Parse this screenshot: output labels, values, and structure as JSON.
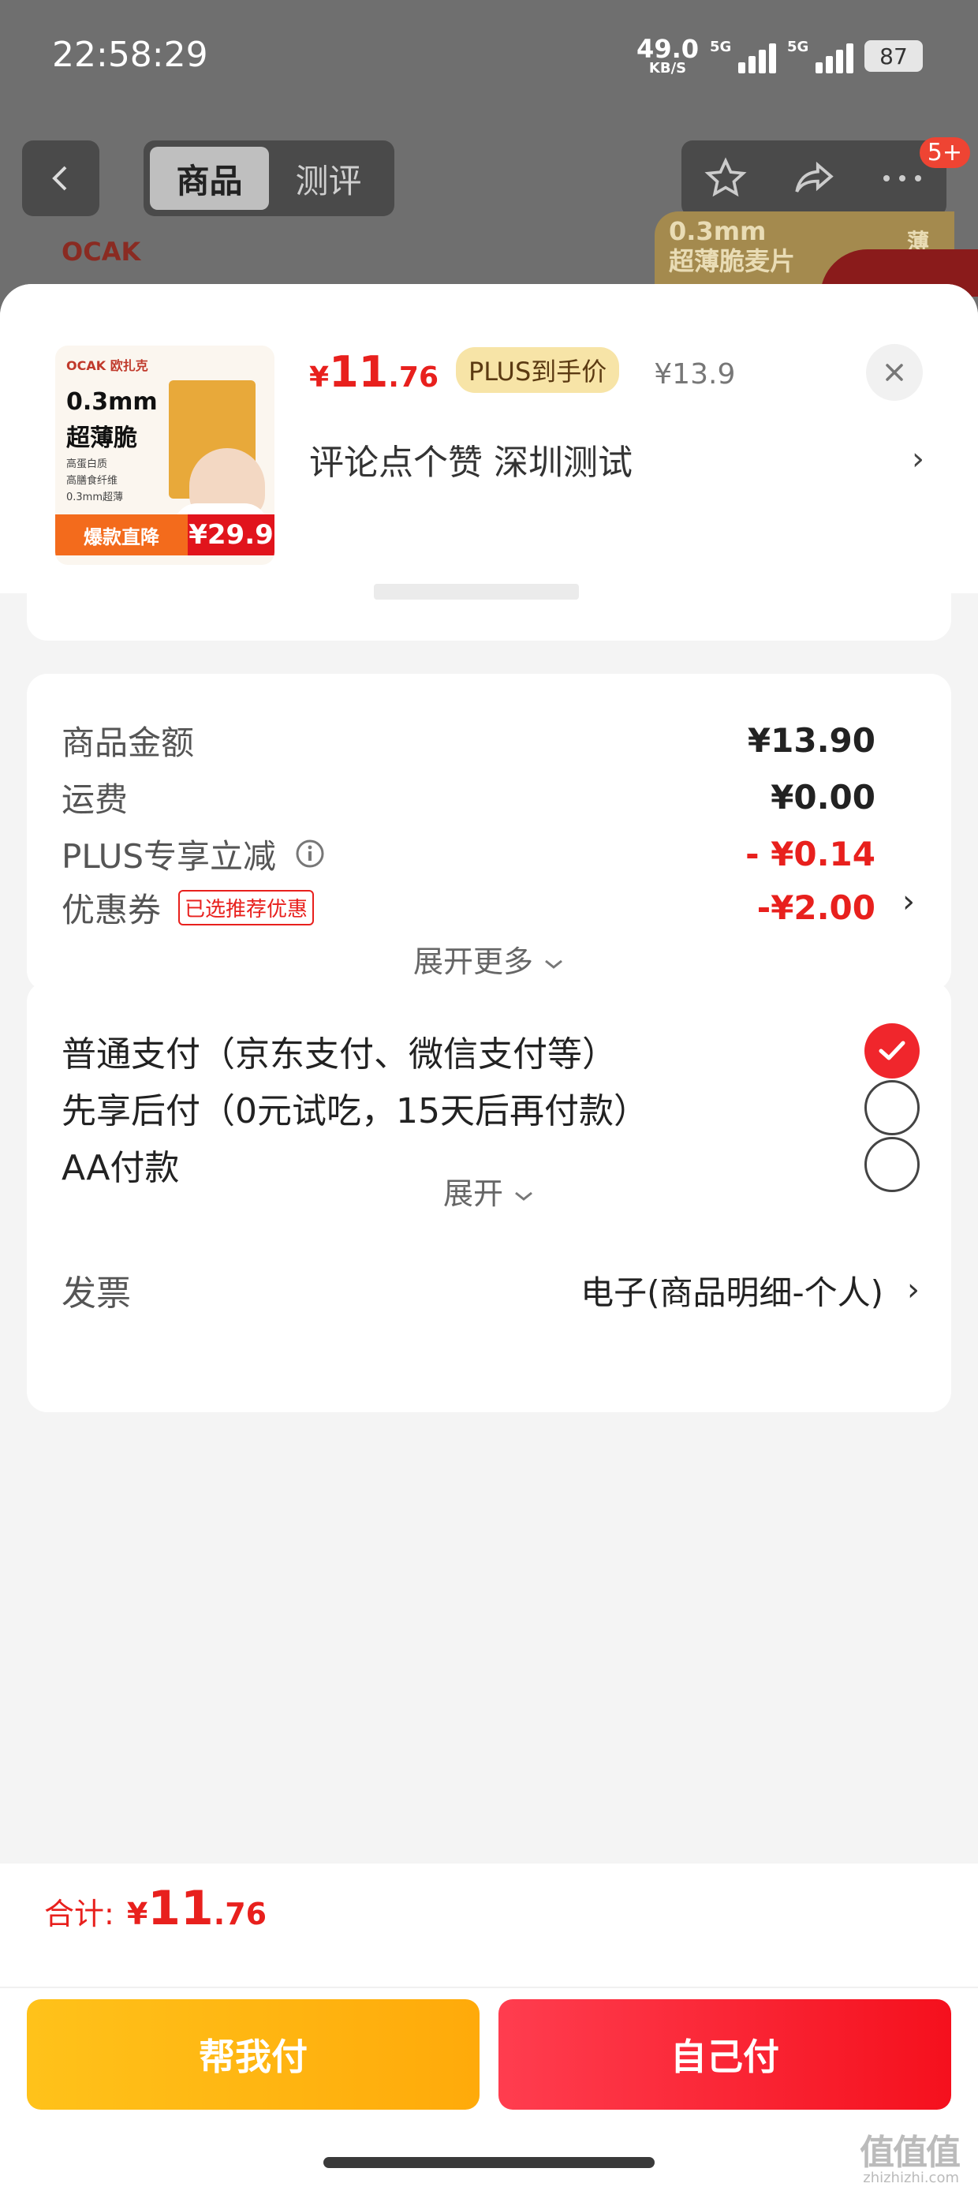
{
  "status": {
    "time": "22:58:29",
    "net_speed": "49.0",
    "net_unit": "KB/S",
    "sim1": "5G",
    "sim2": "5G",
    "battery": "87"
  },
  "nav": {
    "tabs": [
      {
        "label": "商品"
      },
      {
        "label": "测评"
      }
    ],
    "badge": "5+"
  },
  "background": {
    "brand": "OCAK",
    "promo_line1": "0.3mm",
    "promo_line2": "超薄脆麦片",
    "promo_tag": "薄"
  },
  "product": {
    "thumb": {
      "brand": "OCAK 欧扎克",
      "title1": "0.3mm",
      "title2": "超薄脆",
      "features": [
        "高蛋白质",
        "高膳食纤维",
        "0.3mm超薄"
      ],
      "deal_label": "爆款直降",
      "deal_price": "¥29.9"
    },
    "price_currency": "¥",
    "price_int": "11",
    "price_dec": ".76",
    "plus_tag": "PLUS到手价",
    "original_price": "¥13.9",
    "address": "评论点个赞  深圳测试"
  },
  "amounts": {
    "rows": [
      {
        "label": "商品金额",
        "value": "¥13.90"
      },
      {
        "label": "运费",
        "value": "¥0.00"
      },
      {
        "label": "PLUS专享立减",
        "value": "- ¥0.14"
      },
      {
        "label": "优惠券",
        "value": "-¥2.00",
        "tag": "已选推荐优惠"
      }
    ],
    "expand": "展开更多"
  },
  "payment": {
    "options": [
      {
        "label": "普通支付（京东支付、微信支付等）",
        "selected": true
      },
      {
        "label": "先享后付（0元试吃，15天后再付款）",
        "selected": false
      },
      {
        "label": "AA付款",
        "selected": false
      }
    ],
    "expand": "展开"
  },
  "invoice": {
    "label": "发票",
    "value": "电子(商品明细-个人)"
  },
  "footer": {
    "total_label": "合计:",
    "total_currency": "¥",
    "total_int": "11",
    "total_dec": ".76",
    "help_pay": "帮我付",
    "self_pay": "自己付"
  },
  "watermark": {
    "logo": "值值值",
    "site": "zhizhizhi.com"
  },
  "colors": {
    "accent": "#e8201d",
    "plus_gold": "#f7e4a7",
    "help_btn": "#ffb612",
    "self_btn": "#f5101d"
  }
}
